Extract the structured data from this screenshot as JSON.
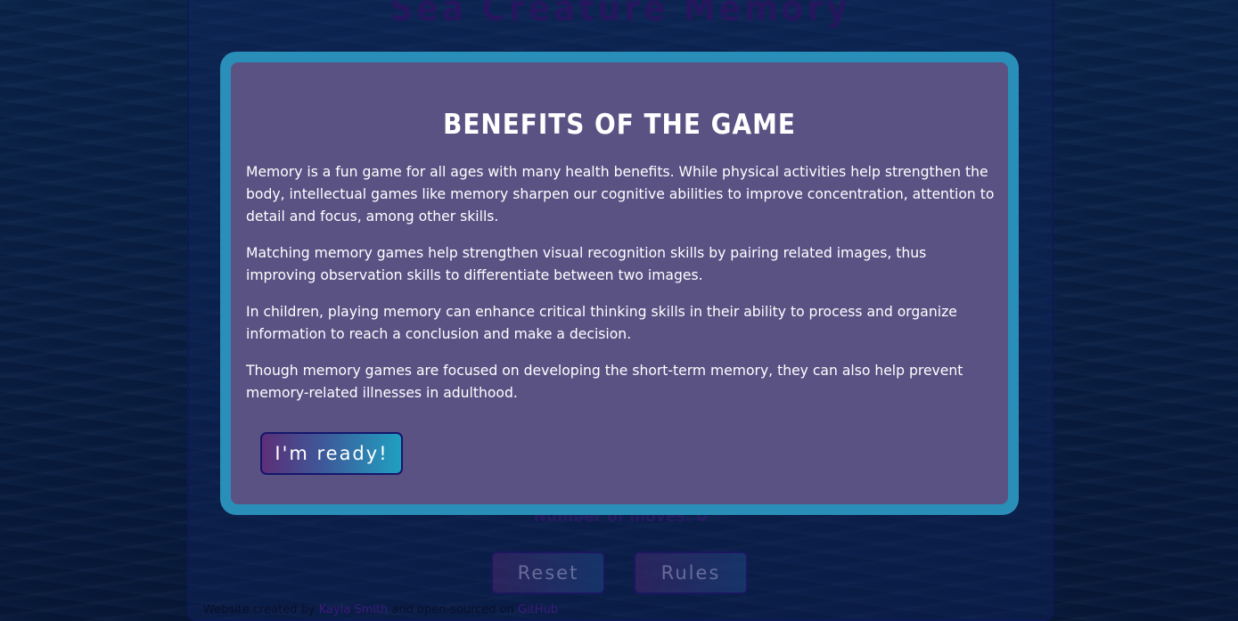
{
  "game": {
    "title": "Sea Creature Memory",
    "moves_label": "Number of moves: 0",
    "reset_label": "Reset",
    "rules_label": "Rules"
  },
  "footer": {
    "prefix": "Website created by ",
    "author": "Kayla Smith",
    "middle": " and open-sourced on ",
    "repo": "GitHub"
  },
  "modal": {
    "title": "BENEFITS OF THE GAME",
    "paragraphs": [
      "Memory is a fun game for all ages with many health benefits. While physical activities help strengthen the body, intellectual games like memory sharpen our cognitive abilities to improve concentration, attention to detail and focus, among other skills.",
      "Matching memory games help strengthen visual recognition skills by pairing related images, thus improving observation skills to differentiate between two images.",
      "In children, playing memory can enhance critical thinking skills in their ability to process and organize information to reach a conclusion and make a decision.",
      "Though memory games are focused on developing the short-term memory, they can also help prevent memory-related illnesses in adulthood."
    ],
    "button_label": "I'm ready!"
  },
  "colors": {
    "modal_border": "#2a8fb8",
    "modal_background": "#5b5284",
    "text": "#ffffff",
    "ocean_background": "#0a2344"
  }
}
